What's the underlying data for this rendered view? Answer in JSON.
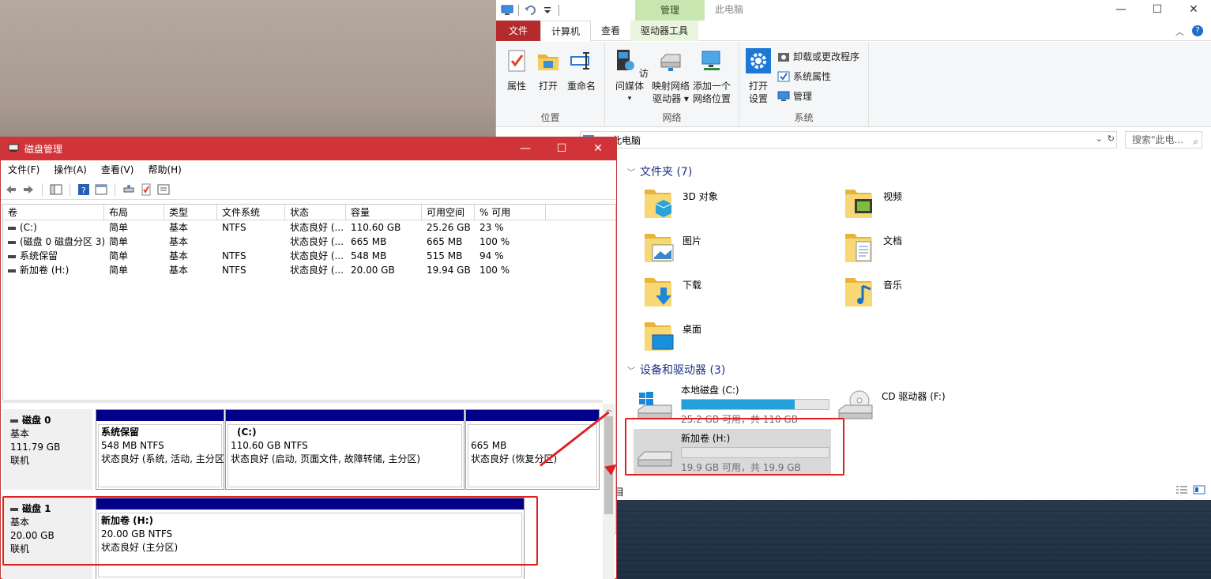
{
  "explorer": {
    "title": "此电脑",
    "ribbon_context": "管理",
    "tabs": {
      "file": "文件",
      "computer": "计算机",
      "view": "查看",
      "drive_tools": "驱动器工具"
    },
    "ribbon": {
      "location": {
        "label": "位置",
        "properties": "属性",
        "open": "打开",
        "rename": "重命名"
      },
      "network": {
        "label": "网络",
        "access_media": "访问媒体",
        "map_drive_1": "映射网络",
        "map_drive_2": "驱动器",
        "add_location_1": "添加一个",
        "add_location_2": "网络位置"
      },
      "system": {
        "label": "系统",
        "open_settings_1": "打开",
        "open_settings_2": "设置",
        "uninstall": "卸载或更改程序",
        "sys_props": "系统属性",
        "manage": "管理"
      }
    },
    "address": "此电脑",
    "search_placeholder": "搜索\"此电...",
    "folders_header": "文件夹 (7)",
    "folders": [
      "3D 对象",
      "视频",
      "图片",
      "文档",
      "下载",
      "音乐",
      "桌面"
    ],
    "devices_header": "设备和驱动器 (3)",
    "drives": {
      "c": {
        "name": "本地磁盘 (C:)",
        "free": "25.2 GB 可用，共 110 GB",
        "used_pct": 77
      },
      "f": {
        "name": "CD 驱动器 (F:)"
      },
      "h": {
        "name": "新加卷 (H:)",
        "free": "19.9 GB 可用，共 19.9 GB",
        "used_pct": 0
      }
    },
    "status_left": "目"
  },
  "diskmgmt": {
    "title": "磁盘管理",
    "menu": [
      "文件(F)",
      "操作(A)",
      "查看(V)",
      "帮助(H)"
    ],
    "columns": [
      "卷",
      "布局",
      "类型",
      "文件系统",
      "状态",
      "容量",
      "可用空间",
      "% 可用"
    ],
    "rows": [
      [
        "(C:)",
        "简单",
        "基本",
        "NTFS",
        "状态良好 (...",
        "110.60 GB",
        "25.26 GB",
        "23 %"
      ],
      [
        "(磁盘 0 磁盘分区 3)",
        "简单",
        "基本",
        "",
        "状态良好 (...",
        "665 MB",
        "665 MB",
        "100 %"
      ],
      [
        "系统保留",
        "简单",
        "基本",
        "NTFS",
        "状态良好 (...",
        "548 MB",
        "515 MB",
        "94 %"
      ],
      [
        "新加卷 (H:)",
        "简单",
        "基本",
        "NTFS",
        "状态良好 (...",
        "20.00 GB",
        "19.94 GB",
        "100 %"
      ]
    ],
    "disk0": {
      "name": "磁盘 0",
      "type": "基本",
      "size": "111.79 GB",
      "state": "联机",
      "parts": [
        {
          "name": "系统保留",
          "size": "548 MB NTFS",
          "status": "状态良好 (系统, 活动, 主分区)"
        },
        {
          "name": "(C:)",
          "size": "110.60 GB NTFS",
          "status": "状态良好 (启动, 页面文件, 故障转储, 主分区)"
        },
        {
          "name": "",
          "size": "665 MB",
          "status": "状态良好 (恢复分区)"
        }
      ]
    },
    "disk1": {
      "name": "磁盘 1",
      "type": "基本",
      "size": "20.00 GB",
      "state": "联机",
      "parts": [
        {
          "name": "新加卷  (H:)",
          "size": "20.00 GB NTFS",
          "status": "状态良好 (主分区)"
        }
      ]
    }
  },
  "colors": {
    "accent_red": "#d13438",
    "highlight": "#e02020",
    "partition_stripe": "#00008b",
    "drive_bar": "#26a0da"
  }
}
